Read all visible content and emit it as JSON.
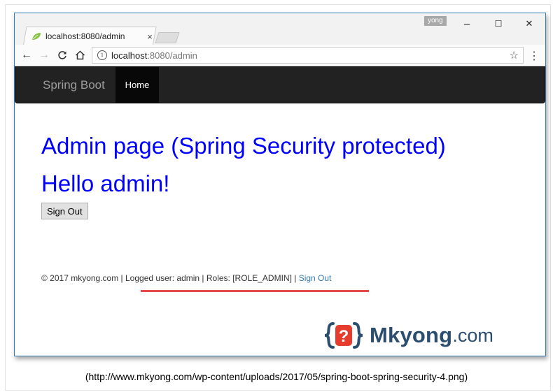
{
  "browser": {
    "tab_title": "localhost:8080/admin",
    "tab_close": "×",
    "user_badge": "yong",
    "controls": {
      "minimize": "–",
      "maximize": "☐",
      "close": "✕"
    },
    "url_host": "localhost",
    "url_path": ":8080/admin"
  },
  "site": {
    "brand": "Spring Boot",
    "nav_home": "Home",
    "heading": "Admin page (Spring Security protected)",
    "greeting": "Hello admin!",
    "signout_button": "Sign Out",
    "footer_text": "© 2017 mkyong.com | Logged user: admin | Roles: [ROLE_ADMIN] | ",
    "footer_link": "Sign Out"
  },
  "logo": {
    "name": "Mkyong",
    "suffix": ".com",
    "icon_glyph": "?"
  },
  "caption": "(http://www.mkyong.com/wp-content/uploads/2017/05/spring-boot-spring-security-4.png)",
  "colors": {
    "heading": "#0000ff",
    "navbar": "#222222",
    "highlight": "#e44c4c",
    "logo": "#2b4d6f",
    "logo_accent": "#e53c2e"
  }
}
